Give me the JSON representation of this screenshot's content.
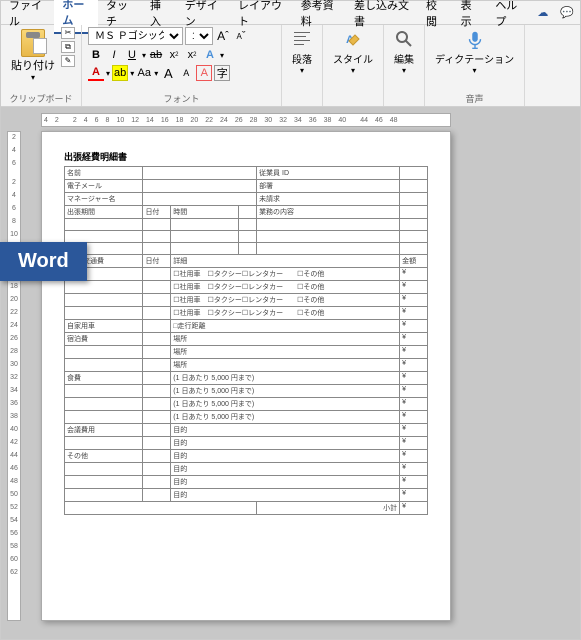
{
  "tabs": {
    "file": "ファイル",
    "home": "ホーム",
    "touch": "タッチ",
    "insert": "挿入",
    "design": "デザイン",
    "layout": "レイアウト",
    "references": "参考資料",
    "mailings": "差し込み文書",
    "review": "校閲",
    "view": "表示",
    "help": "ヘルプ"
  },
  "ribbon": {
    "clipboard": {
      "label": "クリップボード",
      "paste": "貼り付け"
    },
    "font": {
      "label": "フォント",
      "name": "ＭＳ Ｐゴシック",
      "size": "14",
      "bold": "B",
      "italic": "I",
      "underline": "U",
      "strike": "ab",
      "sub": "x₂",
      "sup": "x²",
      "clear": "A",
      "fontcolor": "A",
      "highlight": "ab",
      "charCase": "Aa",
      "grow": "A",
      "shrink": "A",
      "charFx": "A"
    },
    "para": {
      "label": "段落"
    },
    "styles": {
      "label": "スタイル"
    },
    "editing": {
      "label": "編集"
    },
    "voice": {
      "label": "音声",
      "dictation": "ディクテーション"
    }
  },
  "ruler_h": [
    "4",
    "2",
    "",
    "2",
    "4",
    "6",
    "8",
    "10",
    "12",
    "14",
    "16",
    "18",
    "20",
    "22",
    "24",
    "26",
    "28",
    "30",
    "32",
    "34",
    "36",
    "38",
    "40",
    "",
    "44",
    "46",
    "48"
  ],
  "ruler_v": [
    "2",
    "4",
    "6",
    "",
    "2",
    "4",
    "6",
    "8",
    "10",
    "12",
    "14",
    "16",
    "18",
    "20",
    "22",
    "24",
    "26",
    "28",
    "30",
    "32",
    "34",
    "36",
    "38",
    "40",
    "42",
    "44",
    "46",
    "48",
    "50",
    "52",
    "54",
    "56",
    "58",
    "60",
    "62"
  ],
  "doc": {
    "title": "出張経費明細書",
    "rows": {
      "name": "名前",
      "empid": "従業員 ID",
      "email": "電子メール",
      "dept": "部署",
      "mgr": "マネージャー名",
      "call": "未請求",
      "period_from": "出張期間",
      "date_h": "日付",
      "time_h": "時間",
      "purpose_h": "業務の内容",
      "transport": "経費\n交通費",
      "date2": "日付",
      "detail": "詳細",
      "amount": "金額",
      "chk_text": "☐社用車　☐タクシー☐レンタカー　　☐その他",
      "car_use": "自家用車",
      "run_dist": "□走行距離",
      "stay": "宿泊費",
      "place": "場所",
      "meal": "食費",
      "per_day1": "(1 日あたり 5,000 円まで)",
      "conf": "会議費用",
      "purpose2": "目的",
      "other": "その他",
      "purpose3": "目的",
      "subtotal": "小計",
      "yen": "¥"
    }
  },
  "badge": "Word"
}
